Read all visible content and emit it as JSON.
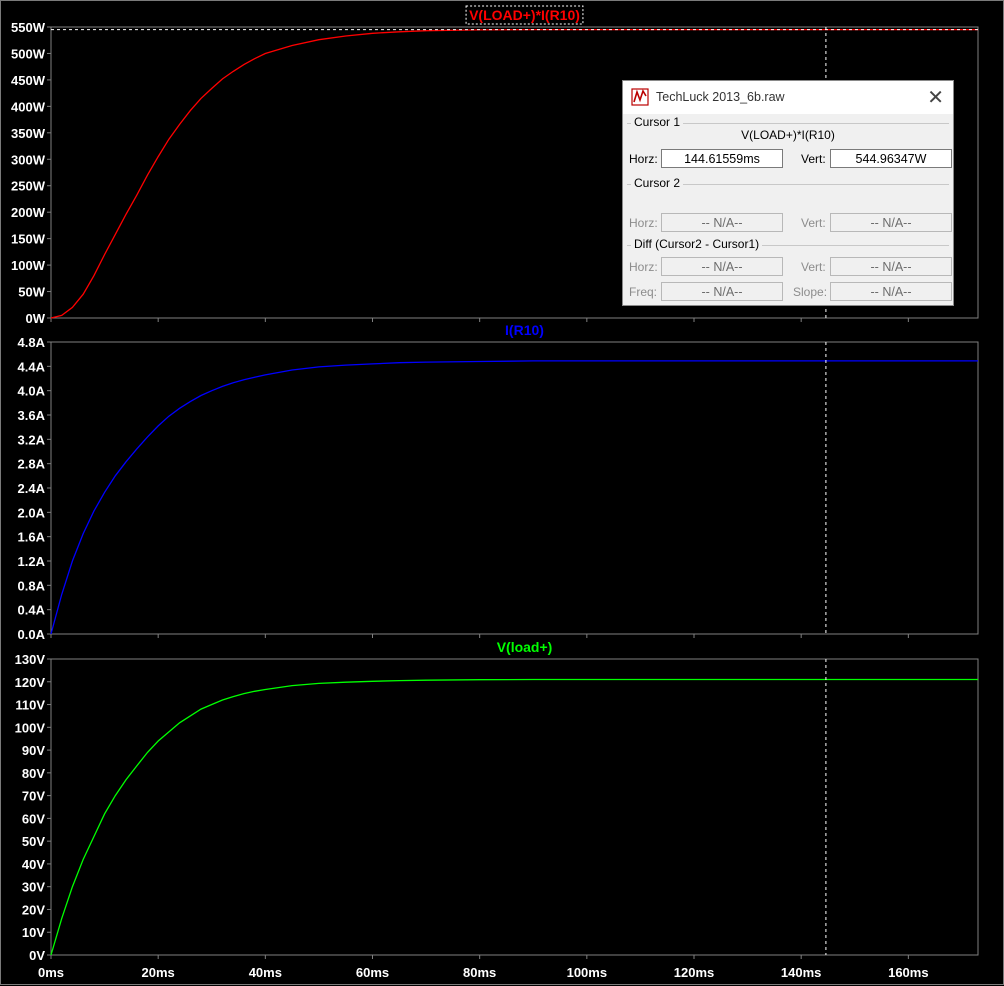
{
  "colors": {
    "background": "#000000",
    "grid": "#808080",
    "axis_text": "#ffffff",
    "cursor_line": "#ffffff"
  },
  "x_axis": {
    "min_ms": 0,
    "max_ms": 173,
    "ticks": [
      {
        "v": 0,
        "label": "0ms"
      },
      {
        "v": 20,
        "label": "20ms"
      },
      {
        "v": 40,
        "label": "40ms"
      },
      {
        "v": 60,
        "label": "60ms"
      },
      {
        "v": 80,
        "label": "80ms"
      },
      {
        "v": 100,
        "label": "100ms"
      },
      {
        "v": 120,
        "label": "120ms"
      },
      {
        "v": 140,
        "label": "140ms"
      },
      {
        "v": 160,
        "label": "160ms"
      }
    ]
  },
  "cursor": {
    "x_ms": 144.61559
  },
  "chart_data": [
    {
      "type": "line",
      "title": "V(LOAD+)*I(R10)",
      "color": "#ff0000",
      "ylim": [
        0,
        550
      ],
      "yticks": [
        {
          "v": 0,
          "label": "0W"
        },
        {
          "v": 50,
          "label": "50W"
        },
        {
          "v": 100,
          "label": "100W"
        },
        {
          "v": 150,
          "label": "150W"
        },
        {
          "v": 200,
          "label": "200W"
        },
        {
          "v": 250,
          "label": "250W"
        },
        {
          "v": 300,
          "label": "300W"
        },
        {
          "v": 350,
          "label": "350W"
        },
        {
          "v": 400,
          "label": "400W"
        },
        {
          "v": 450,
          "label": "450W"
        },
        {
          "v": 500,
          "label": "500W"
        },
        {
          "v": 550,
          "label": "550W"
        }
      ],
      "x_ms": [
        0,
        2,
        4,
        6,
        8,
        10,
        12,
        14,
        16,
        18,
        20,
        22,
        24,
        26,
        28,
        30,
        32,
        34,
        36,
        38,
        40,
        45,
        50,
        55,
        60,
        65,
        70,
        80,
        90,
        100,
        120,
        140,
        160,
        173
      ],
      "values": [
        0,
        5,
        20,
        45,
        80,
        120,
        158,
        196,
        232,
        270,
        305,
        338,
        366,
        392,
        415,
        434,
        452,
        466,
        479,
        490,
        500,
        515,
        526,
        533,
        538,
        541,
        543,
        544.5,
        545,
        545,
        545,
        545,
        545,
        545
      ]
    },
    {
      "type": "line",
      "title": "I(R10)",
      "color": "#0000ff",
      "ylim": [
        0,
        4.8
      ],
      "yticks": [
        {
          "v": 0,
          "label": "0.0A"
        },
        {
          "v": 0.4,
          "label": "0.4A"
        },
        {
          "v": 0.8,
          "label": "0.8A"
        },
        {
          "v": 1.2,
          "label": "1.2A"
        },
        {
          "v": 1.6,
          "label": "1.6A"
        },
        {
          "v": 2.0,
          "label": "2.0A"
        },
        {
          "v": 2.4,
          "label": "2.4A"
        },
        {
          "v": 2.8,
          "label": "2.8A"
        },
        {
          "v": 3.2,
          "label": "3.2A"
        },
        {
          "v": 3.6,
          "label": "3.6A"
        },
        {
          "v": 4.0,
          "label": "4.0A"
        },
        {
          "v": 4.4,
          "label": "4.4A"
        },
        {
          "v": 4.8,
          "label": "4.8A"
        }
      ],
      "x_ms": [
        0,
        2,
        4,
        6,
        8,
        10,
        12,
        14,
        16,
        18,
        20,
        22,
        24,
        26,
        28,
        30,
        32,
        34,
        36,
        38,
        40,
        45,
        50,
        55,
        60,
        65,
        70,
        80,
        90,
        100,
        120,
        140,
        160,
        173
      ],
      "values": [
        0,
        0.65,
        1.2,
        1.65,
        2.02,
        2.33,
        2.6,
        2.83,
        3.04,
        3.24,
        3.42,
        3.58,
        3.71,
        3.82,
        3.92,
        4.0,
        4.07,
        4.13,
        4.18,
        4.22,
        4.26,
        4.34,
        4.39,
        4.42,
        4.44,
        4.46,
        4.47,
        4.48,
        4.49,
        4.49,
        4.49,
        4.49,
        4.49,
        4.49
      ]
    },
    {
      "type": "line",
      "title": "V(load+)",
      "color": "#00ff00",
      "ylim": [
        0,
        130
      ],
      "yticks": [
        {
          "v": 0,
          "label": "0V"
        },
        {
          "v": 10,
          "label": "10V"
        },
        {
          "v": 20,
          "label": "20V"
        },
        {
          "v": 30,
          "label": "30V"
        },
        {
          "v": 40,
          "label": "40V"
        },
        {
          "v": 50,
          "label": "50V"
        },
        {
          "v": 60,
          "label": "60V"
        },
        {
          "v": 70,
          "label": "70V"
        },
        {
          "v": 80,
          "label": "80V"
        },
        {
          "v": 90,
          "label": "90V"
        },
        {
          "v": 100,
          "label": "100V"
        },
        {
          "v": 110,
          "label": "110V"
        },
        {
          "v": 120,
          "label": "120V"
        },
        {
          "v": 130,
          "label": "130V"
        }
      ],
      "x_ms": [
        0,
        2,
        4,
        6,
        8,
        10,
        12,
        14,
        16,
        18,
        20,
        22,
        24,
        26,
        28,
        30,
        32,
        34,
        36,
        38,
        40,
        45,
        50,
        55,
        60,
        65,
        70,
        80,
        90,
        100,
        120,
        140,
        160,
        173
      ],
      "values": [
        0,
        16,
        30,
        42,
        52,
        62,
        70,
        77,
        83,
        89,
        94,
        98,
        102,
        105,
        108,
        110,
        112,
        113.5,
        114.8,
        115.8,
        116.6,
        118.3,
        119.3,
        119.8,
        120.2,
        120.5,
        120.7,
        120.9,
        121,
        121,
        121,
        121,
        121,
        121
      ]
    }
  ],
  "dialog": {
    "title": "TechLuck 2013_6b.raw",
    "close_glyph": "✕",
    "cursor1": {
      "label": "Cursor 1",
      "trace": "V(LOAD+)*I(R10)",
      "horz_label": "Horz:",
      "horz_value": "144.61559ms",
      "vert_label": "Vert:",
      "vert_value": "544.96347W"
    },
    "cursor2": {
      "label": "Cursor 2",
      "horz_label": "Horz:",
      "horz_value": "-- N/A--",
      "vert_label": "Vert:",
      "vert_value": "-- N/A--"
    },
    "diff": {
      "label": "Diff (Cursor2 - Cursor1)",
      "horz_label": "Horz:",
      "horz_value": "-- N/A--",
      "vert_label": "Vert:",
      "vert_value": "-- N/A--",
      "freq_label": "Freq:",
      "freq_value": "-- N/A--",
      "slope_label": "Slope:",
      "slope_value": "-- N/A--"
    }
  }
}
